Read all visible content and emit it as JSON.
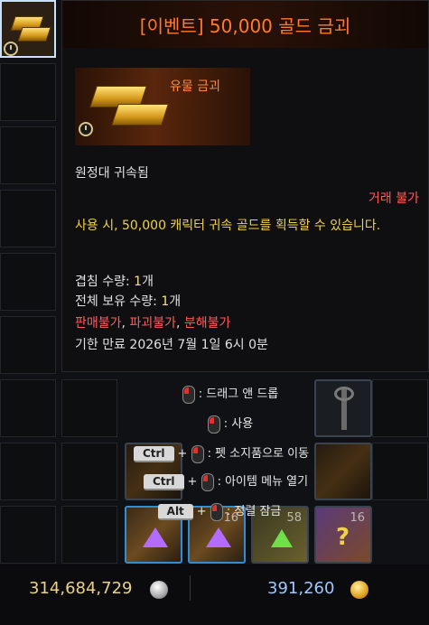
{
  "tooltip": {
    "title": "[이벤트] 50,000 골드 금괴",
    "image_label": "유물 금괴",
    "bound": "원정대 귀속됨",
    "trade": "거래 불가",
    "description": "사용 시, 50,000 캐릭터 귀속 골드를 획득할 수 있습니다.",
    "stack_label": "겹침 수량: ",
    "stack_value": "1",
    "stack_unit": "개",
    "own_label": "전체 보유 수량: ",
    "own_value": "1",
    "own_unit": "개",
    "restrict_sell": "판매불가",
    "restrict_destroy": "파괴불가",
    "restrict_dismantle": "분해불가",
    "sep": ", ",
    "expiry": "기한 만료 2026년 7월 1일 6시 0분"
  },
  "hints": {
    "drag": ": 드래그 앤 드롭",
    "use": ": 사용",
    "ctrl_key": "Ctrl",
    "plus": "+",
    "pet": ": 펫 소지품으로 이동",
    "menu": ": 아이템 메뉴 열기",
    "alt_key": "Alt",
    "lock": ": 정렬 잠금"
  },
  "inventory": {
    "count_1": "16",
    "count_2": "58",
    "count_3": "16"
  },
  "footer": {
    "silver": "314,684,729",
    "gold": "391,260"
  },
  "colors": {
    "title": "#ff7a2c",
    "gold_text": "#f0d24a",
    "red_text": "#ff5a5a",
    "silver_text": "#e8d28a",
    "gold_amount": "#9ec8ff"
  }
}
